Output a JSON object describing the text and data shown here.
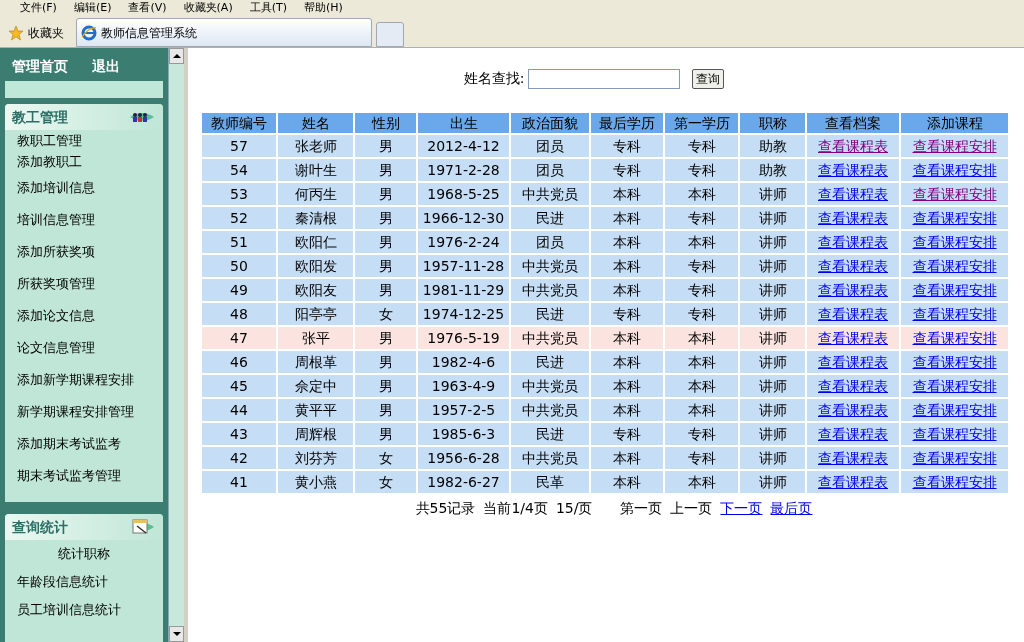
{
  "menu": [
    "文件(F)",
    "编辑(E)",
    "查看(V)",
    "收藏夹(A)",
    "工具(T)",
    "帮助(H)"
  ],
  "favorites": "收藏夹",
  "tab": {
    "title": "教师信息管理系统"
  },
  "sidebar": {
    "top_links": [
      "管理首页",
      "退出"
    ],
    "sections": [
      {
        "title": "教工管理",
        "items": [
          {
            "label": "教职工管理",
            "kind": "link"
          },
          {
            "label": "添加教职工",
            "kind": "link"
          },
          {
            "label": "添加培训信息",
            "kind": "link"
          },
          {
            "label": "培训信息管理",
            "kind": "link"
          },
          {
            "label": "添加所获奖项",
            "kind": "link"
          },
          {
            "label": "所获奖项管理",
            "kind": "link"
          },
          {
            "label": "添加论文信息",
            "kind": "link"
          },
          {
            "label": "论文信息管理",
            "kind": "link"
          },
          {
            "label": "添加新学期课程安排",
            "kind": "link"
          },
          {
            "label": "新学期课程安排管理",
            "kind": "link"
          },
          {
            "label": "添加期末考试监考",
            "kind": "link"
          },
          {
            "label": "期末考试监考管理",
            "kind": "link"
          }
        ]
      },
      {
        "title": "查询统计",
        "items": [
          {
            "label": "统计职称",
            "kind": "centered"
          },
          {
            "label": "年龄段信息统计",
            "kind": "link"
          },
          {
            "label": "员工培训信息统计",
            "kind": "link"
          }
        ]
      }
    ]
  },
  "search": {
    "label": "姓名查找:",
    "button": "查询"
  },
  "table": {
    "columns": [
      "教师编号",
      "姓名",
      "性别",
      "出生",
      "政治面貌",
      "最后学历",
      "第一学历",
      "职称",
      "查看档案",
      "添加课程"
    ],
    "rows": [
      {
        "cells": [
          "57",
          "张老师",
          "男",
          "2012-4-12",
          "团员",
          "专科",
          "专科",
          "助教"
        ],
        "links": [
          {
            "text": "查看课程表",
            "visited": true
          },
          {
            "text": "查看课程安排",
            "visited": true
          }
        ],
        "highlighted": false
      },
      {
        "cells": [
          "54",
          "谢叶生",
          "男",
          "1971-2-28",
          "团员",
          "专科",
          "专科",
          "助教"
        ],
        "links": [
          {
            "text": "查看课程表",
            "visited": false
          },
          {
            "text": "查看课程安排",
            "visited": false
          }
        ],
        "highlighted": false
      },
      {
        "cells": [
          "53",
          "何丙生",
          "男",
          "1968-5-25",
          "中共党员",
          "本科",
          "本科",
          "讲师"
        ],
        "links": [
          {
            "text": "查看课程表",
            "visited": false
          },
          {
            "text": "查看课程安排",
            "visited": true
          }
        ],
        "highlighted": false
      },
      {
        "cells": [
          "52",
          "秦清根",
          "男",
          "1966-12-30",
          "民进",
          "本科",
          "专科",
          "讲师"
        ],
        "links": [
          {
            "text": "查看课程表",
            "visited": false
          },
          {
            "text": "查看课程安排",
            "visited": false
          }
        ],
        "highlighted": false
      },
      {
        "cells": [
          "51",
          "欧阳仁",
          "男",
          "1976-2-24",
          "团员",
          "本科",
          "本科",
          "讲师"
        ],
        "links": [
          {
            "text": "查看课程表",
            "visited": false
          },
          {
            "text": "查看课程安排",
            "visited": false
          }
        ],
        "highlighted": false
      },
      {
        "cells": [
          "50",
          "欧阳发",
          "男",
          "1957-11-28",
          "中共党员",
          "本科",
          "专科",
          "讲师"
        ],
        "links": [
          {
            "text": "查看课程表",
            "visited": false
          },
          {
            "text": "查看课程安排",
            "visited": false
          }
        ],
        "highlighted": false
      },
      {
        "cells": [
          "49",
          "欧阳友",
          "男",
          "1981-11-29",
          "中共党员",
          "本科",
          "专科",
          "讲师"
        ],
        "links": [
          {
            "text": "查看课程表",
            "visited": false
          },
          {
            "text": "查看课程安排",
            "visited": false
          }
        ],
        "highlighted": false
      },
      {
        "cells": [
          "48",
          "阳亭亭",
          "女",
          "1974-12-25",
          "民进",
          "专科",
          "专科",
          "讲师"
        ],
        "links": [
          {
            "text": "查看课程表",
            "visited": false
          },
          {
            "text": "查看课程安排",
            "visited": false
          }
        ],
        "highlighted": false
      },
      {
        "cells": [
          "47",
          "张平",
          "男",
          "1976-5-19",
          "中共党员",
          "本科",
          "本科",
          "讲师"
        ],
        "links": [
          {
            "text": "查看课程表",
            "visited": false
          },
          {
            "text": "查看课程安排",
            "visited": false
          }
        ],
        "highlighted": true
      },
      {
        "cells": [
          "46",
          "周根革",
          "男",
          "1982-4-6",
          "民进",
          "本科",
          "本科",
          "讲师"
        ],
        "links": [
          {
            "text": "查看课程表",
            "visited": false
          },
          {
            "text": "查看课程安排",
            "visited": false
          }
        ],
        "highlighted": false
      },
      {
        "cells": [
          "45",
          "佘定中",
          "男",
          "1963-4-9",
          "中共党员",
          "本科",
          "本科",
          "讲师"
        ],
        "links": [
          {
            "text": "查看课程表",
            "visited": false
          },
          {
            "text": "查看课程安排",
            "visited": false
          }
        ],
        "highlighted": false
      },
      {
        "cells": [
          "44",
          "黄平平",
          "男",
          "1957-2-5",
          "中共党员",
          "本科",
          "本科",
          "讲师"
        ],
        "links": [
          {
            "text": "查看课程表",
            "visited": false
          },
          {
            "text": "查看课程安排",
            "visited": false
          }
        ],
        "highlighted": false
      },
      {
        "cells": [
          "43",
          "周辉根",
          "男",
          "1985-6-3",
          "民进",
          "专科",
          "专科",
          "讲师"
        ],
        "links": [
          {
            "text": "查看课程表",
            "visited": false
          },
          {
            "text": "查看课程安排",
            "visited": false
          }
        ],
        "highlighted": false
      },
      {
        "cells": [
          "42",
          "刘芬芳",
          "女",
          "1956-6-28",
          "中共党员",
          "本科",
          "专科",
          "讲师"
        ],
        "links": [
          {
            "text": "查看课程表",
            "visited": false
          },
          {
            "text": "查看课程安排",
            "visited": false
          }
        ],
        "highlighted": false
      },
      {
        "cells": [
          "41",
          "黄小燕",
          "女",
          "1982-6-27",
          "民革",
          "本科",
          "本科",
          "讲师"
        ],
        "links": [
          {
            "text": "查看课程表",
            "visited": false
          },
          {
            "text": "查看课程安排",
            "visited": false
          }
        ],
        "highlighted": false
      }
    ]
  },
  "pagination": [
    {
      "text": "共55记录",
      "kind": "text"
    },
    {
      "text": "当前1/4页",
      "kind": "text"
    },
    {
      "text": "15/页",
      "kind": "text"
    },
    {
      "text": "第一页",
      "kind": "text"
    },
    {
      "text": "上一页",
      "kind": "text"
    },
    {
      "text": "下一页",
      "kind": "link"
    },
    {
      "text": "最后页",
      "kind": "link"
    }
  ]
}
